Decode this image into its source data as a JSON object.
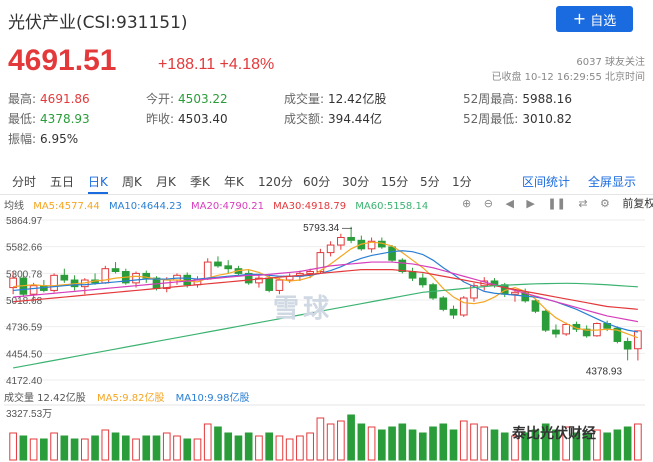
{
  "header": {
    "title": "光伏产业(CSI:931151)",
    "add_label": "自选",
    "price": "4691.51",
    "change": "+188.11 +4.18%",
    "followers": "6037 球友关注",
    "status": "已收盘 10-12 16:29:55 北京时间"
  },
  "stats": {
    "high_label": "最高:",
    "high": "4691.86",
    "open_label": "今开:",
    "open": "4503.22",
    "volume_label": "成交量:",
    "volume": "12.42亿股",
    "w52_high_label": "52周最高:",
    "w52_high": "5988.16",
    "low_label": "最低:",
    "low": "4378.93",
    "prev_label": "昨收:",
    "prev": "4503.40",
    "amount_label": "成交额:",
    "amount": "394.44亿",
    "w52_low_label": "52周最低:",
    "w52_low": "3010.82",
    "amp_label": "振幅:",
    "amp": "6.95%"
  },
  "tabs": [
    "分时",
    "五日",
    "日K",
    "周K",
    "月K",
    "季K",
    "年K",
    "120分",
    "60分",
    "30分",
    "15分",
    "5分",
    "1分"
  ],
  "active_tab": "日K",
  "right_tabs": [
    "区间统计",
    "全屏显示"
  ],
  "legend": {
    "label": "均线",
    "ma5": "MA5:4577.44",
    "ma10": "MA10:4644.23",
    "ma20": "MA20:4790.21",
    "ma30": "MA30:4918.79",
    "ma60": "MA60:5158.14"
  },
  "tools": [
    "⊕",
    "⊖",
    "◀",
    "▶",
    "❚❚",
    "⇄",
    "⚙"
  ],
  "adjust": "前复权",
  "volume_legend": {
    "label": "成交量 12.42亿股",
    "ma5": "MA5:9.82亿股",
    "ma10": "MA10:9.98亿股",
    "max": "3327.53万"
  },
  "watermark": "雪球",
  "watermark2": "泰比光伏财经",
  "colors": {
    "up": "#e3393b",
    "down": "#2a9d3a",
    "ma5": "#f5a623",
    "ma10": "#2a7fd4",
    "ma20": "#d63fbc",
    "ma30": "#e3393b",
    "ma60": "#3cb371",
    "accent": "#1a6be0"
  },
  "chart_data": {
    "type": "candlestick",
    "y_ticks": [
      "5864.97",
      "5582.66",
      "5300.78",
      "5018.68",
      "4736.59",
      "4454.50",
      "4172.40"
    ],
    "ylim": [
      4172.4,
      5864.97
    ],
    "peak_label": "5793.34",
    "trough_label": "4378.93",
    "ohlc": [
      [
        5150,
        5320,
        5080,
        5250
      ],
      [
        5250,
        5300,
        5050,
        5080
      ],
      [
        5080,
        5200,
        5000,
        5170
      ],
      [
        5170,
        5230,
        5100,
        5120
      ],
      [
        5120,
        5300,
        5100,
        5280
      ],
      [
        5280,
        5350,
        5200,
        5230
      ],
      [
        5230,
        5280,
        5120,
        5160
      ],
      [
        5160,
        5250,
        5080,
        5230
      ],
      [
        5230,
        5300,
        5180,
        5200
      ],
      [
        5200,
        5380,
        5190,
        5350
      ],
      [
        5350,
        5420,
        5300,
        5320
      ],
      [
        5320,
        5350,
        5180,
        5200
      ],
      [
        5200,
        5320,
        5150,
        5300
      ],
      [
        5300,
        5330,
        5200,
        5250
      ],
      [
        5250,
        5270,
        5120,
        5140
      ],
      [
        5140,
        5260,
        5100,
        5230
      ],
      [
        5230,
        5300,
        5180,
        5280
      ],
      [
        5280,
        5310,
        5150,
        5180
      ],
      [
        5180,
        5270,
        5150,
        5240
      ],
      [
        5240,
        5460,
        5230,
        5420
      ],
      [
        5420,
        5480,
        5360,
        5380
      ],
      [
        5380,
        5440,
        5300,
        5350
      ],
      [
        5350,
        5380,
        5280,
        5300
      ],
      [
        5300,
        5340,
        5180,
        5200
      ],
      [
        5200,
        5280,
        5150,
        5250
      ],
      [
        5250,
        5290,
        5100,
        5120
      ],
      [
        5120,
        5250,
        5080,
        5230
      ],
      [
        5230,
        5300,
        5200,
        5270
      ],
      [
        5270,
        5330,
        5220,
        5300
      ],
      [
        5300,
        5350,
        5250,
        5320
      ],
      [
        5320,
        5560,
        5300,
        5520
      ],
      [
        5520,
        5640,
        5480,
        5600
      ],
      [
        5600,
        5720,
        5550,
        5680
      ],
      [
        5680,
        5793,
        5620,
        5650
      ],
      [
        5650,
        5700,
        5540,
        5560
      ],
      [
        5560,
        5680,
        5520,
        5640
      ],
      [
        5640,
        5680,
        5560,
        5580
      ],
      [
        5580,
        5600,
        5420,
        5440
      ],
      [
        5440,
        5460,
        5300,
        5320
      ],
      [
        5320,
        5360,
        5220,
        5250
      ],
      [
        5250,
        5300,
        5150,
        5180
      ],
      [
        5180,
        5200,
        5020,
        5040
      ],
      [
        5040,
        5060,
        4900,
        4920
      ],
      [
        4920,
        4960,
        4820,
        4860
      ],
      [
        4860,
        5060,
        4840,
        5040
      ],
      [
        5040,
        5200,
        5000,
        5170
      ],
      [
        5170,
        5260,
        5120,
        5220
      ],
      [
        5220,
        5250,
        5150,
        5180
      ],
      [
        5180,
        5200,
        5050,
        5080
      ],
      [
        5080,
        5130,
        5000,
        5100
      ],
      [
        5100,
        5140,
        4990,
        5010
      ],
      [
        5010,
        5030,
        4880,
        4900
      ],
      [
        4900,
        4920,
        4680,
        4700
      ],
      [
        4700,
        4760,
        4620,
        4660
      ],
      [
        4660,
        4780,
        4640,
        4760
      ],
      [
        4760,
        4790,
        4680,
        4710
      ],
      [
        4710,
        4750,
        4620,
        4640
      ],
      [
        4640,
        4780,
        4630,
        4770
      ],
      [
        4770,
        4800,
        4690,
        4720
      ],
      [
        4720,
        4740,
        4560,
        4580
      ],
      [
        4580,
        4620,
        4380,
        4500
      ],
      [
        4503,
        4692,
        4379,
        4692
      ]
    ],
    "volume": [
      9,
      8,
      7,
      7,
      9,
      8,
      7,
      7,
      8,
      10,
      9,
      8,
      7,
      8,
      8,
      9,
      8,
      7,
      7,
      12,
      11,
      9,
      8,
      9,
      8,
      9,
      8,
      7,
      8,
      9,
      14,
      12,
      13,
      15,
      12,
      11,
      10,
      11,
      12,
      10,
      9,
      11,
      12,
      10,
      13,
      12,
      11,
      10,
      9,
      8,
      9,
      10,
      12,
      10,
      11,
      9,
      9,
      10,
      9,
      10,
      11,
      12
    ],
    "ma": {
      "ma5": [
        5160,
        5170,
        5180,
        5170,
        5170,
        5180,
        5190,
        5200,
        5220,
        5230,
        5250,
        5260,
        5270,
        5260,
        5240,
        5230,
        5230,
        5220,
        5210,
        5250,
        5280,
        5300,
        5330,
        5340,
        5310,
        5260,
        5240,
        5220,
        5230,
        5260,
        5330,
        5400,
        5480,
        5560,
        5610,
        5630,
        5620,
        5590,
        5520,
        5440,
        5360,
        5260,
        5140,
        5050,
        4990,
        4980,
        5000,
        5050,
        5120,
        5150,
        5110,
        5030,
        4920,
        4830,
        4770,
        4720,
        4700,
        4700,
        4710,
        4700,
        4660,
        4620
      ],
      "ma10": [
        5120,
        5130,
        5140,
        5150,
        5160,
        5170,
        5180,
        5180,
        5190,
        5200,
        5210,
        5220,
        5230,
        5240,
        5240,
        5240,
        5250,
        5250,
        5240,
        5250,
        5260,
        5270,
        5280,
        5290,
        5290,
        5280,
        5270,
        5270,
        5270,
        5280,
        5300,
        5330,
        5370,
        5420,
        5460,
        5490,
        5510,
        5530,
        5540,
        5530,
        5500,
        5440,
        5360,
        5290,
        5210,
        5160,
        5110,
        5090,
        5080,
        5070,
        5060,
        5050,
        5030,
        5000,
        4960,
        4920,
        4870,
        4820,
        4770,
        4730,
        4700,
        4680
      ],
      "ma20": [
        5050,
        5060,
        5070,
        5080,
        5090,
        5100,
        5110,
        5120,
        5130,
        5140,
        5150,
        5160,
        5170,
        5180,
        5190,
        5200,
        5210,
        5220,
        5230,
        5240,
        5250,
        5260,
        5270,
        5280,
        5280,
        5290,
        5300,
        5310,
        5320,
        5340,
        5360,
        5380,
        5390,
        5400,
        5410,
        5420,
        5420,
        5420,
        5410,
        5400,
        5380,
        5360,
        5330,
        5300,
        5270,
        5240,
        5210,
        5180,
        5150,
        5120,
        5090,
        5060,
        5030,
        5000,
        4970,
        4940,
        4910,
        4880,
        4850,
        4830,
        4810,
        4790
      ],
      "ma30": [
        5000,
        5010,
        5020,
        5030,
        5040,
        5050,
        5060,
        5070,
        5080,
        5090,
        5100,
        5110,
        5120,
        5130,
        5140,
        5150,
        5160,
        5170,
        5180,
        5190,
        5200,
        5210,
        5220,
        5230,
        5240,
        5250,
        5260,
        5270,
        5280,
        5290,
        5300,
        5310,
        5320,
        5330,
        5340,
        5340,
        5340,
        5340,
        5330,
        5320,
        5310,
        5290,
        5270,
        5250,
        5230,
        5210,
        5190,
        5170,
        5150,
        5130,
        5110,
        5090,
        5070,
        5050,
        5030,
        5010,
        4990,
        4970,
        4950,
        4940,
        4930,
        4920
      ],
      "ma60": [
        4300,
        4320,
        4340,
        4360,
        4380,
        4400,
        4420,
        4440,
        4460,
        4480,
        4500,
        4520,
        4540,
        4560,
        4580,
        4600,
        4620,
        4640,
        4660,
        4680,
        4700,
        4720,
        4740,
        4760,
        4780,
        4800,
        4820,
        4840,
        4860,
        4880,
        4900,
        4920,
        4940,
        4960,
        4980,
        5000,
        5020,
        5040,
        5060,
        5080,
        5100,
        5110,
        5120,
        5130,
        5140,
        5150,
        5160,
        5170,
        5175,
        5180,
        5185,
        5190,
        5192,
        5194,
        5195,
        5194,
        5190,
        5185,
        5180,
        5172,
        5165,
        5158
      ]
    }
  }
}
